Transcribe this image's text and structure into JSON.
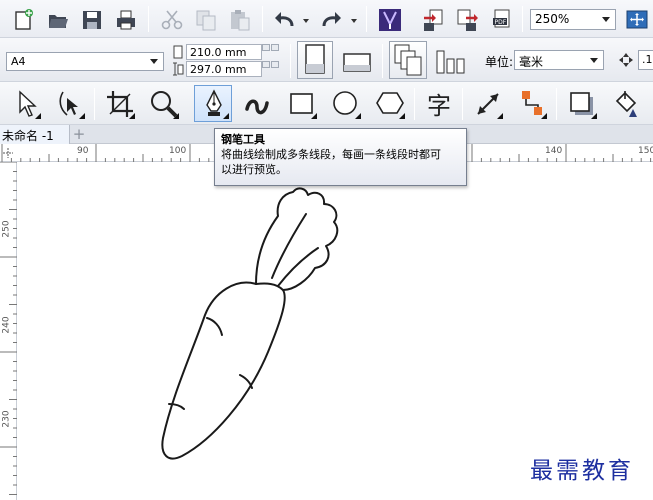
{
  "toolbar": {
    "zoom_value": "250%"
  },
  "property_bar": {
    "page_size": "A4",
    "width": "210.0 mm",
    "height": "297.0 mm",
    "units_label": "单位:",
    "units_value": "毫米",
    "nudge_value": ".1"
  },
  "document": {
    "tab_label": "未命名 -1",
    "new_tab_symbol": "+"
  },
  "rulers": {
    "top_labels": [
      "90",
      "100",
      "140",
      "150"
    ],
    "left_labels": [
      "250",
      "240",
      "230"
    ]
  },
  "tooltip": {
    "title": "钢笔工具",
    "line1": "将曲线绘制成多条线段，每画一条线段时都可",
    "line2": "以进行预览。"
  },
  "watermark": "最需教育",
  "icons": {
    "new": "new-document-icon",
    "open": "open-folder-icon",
    "save": "save-icon",
    "print": "print-icon",
    "cut": "cut-icon",
    "copy": "copy-icon",
    "paste": "paste-icon",
    "undo": "undo-icon",
    "redo": "redo-icon",
    "search": "search-content-icon",
    "import": "import-icon",
    "export": "export-icon",
    "pdf": "publish-pdf-icon",
    "fullscreen": "full-screen-icon"
  },
  "colors": {
    "accent": "#6e9fd8",
    "watermark": "#1d2fa0"
  }
}
